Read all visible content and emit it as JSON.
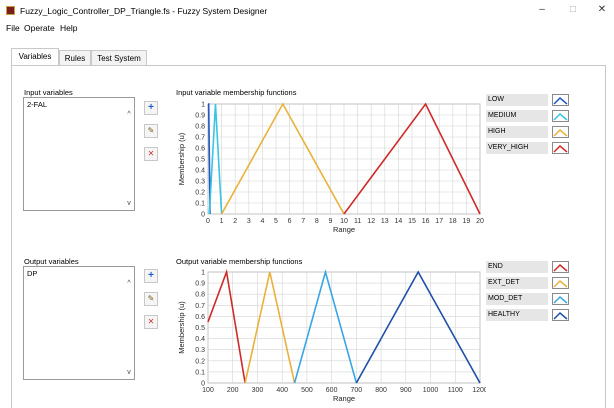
{
  "window": {
    "title": "Fuzzy_Logic_Controller_DP_Triangle.fs - Fuzzy System Designer",
    "minimize": "–",
    "maximize": "□",
    "close": "✕"
  },
  "menu": [
    "File",
    "Operate",
    "Help"
  ],
  "tabs": [
    "Variables",
    "Rules",
    "Test System"
  ],
  "input": {
    "list_label": "Input variables",
    "items": [
      "2-FAL"
    ],
    "chart_label": "Input variable membership functions",
    "legend": [
      {
        "name": "LOW",
        "color": "#1f57c3"
      },
      {
        "name": "MEDIUM",
        "color": "#38c4e6"
      },
      {
        "name": "HIGH",
        "color": "#e9b03b"
      },
      {
        "name": "VERY_HIGH",
        "color": "#d02a2a"
      }
    ]
  },
  "output": {
    "list_label": "Output variables",
    "items": [
      "DP"
    ],
    "chart_label": "Output variable membership functions",
    "legend": [
      {
        "name": "END",
        "color": "#d02a2a"
      },
      {
        "name": "EXT_DET",
        "color": "#e9b03b"
      },
      {
        "name": "MOD_DET",
        "color": "#38a6e6"
      },
      {
        "name": "HEALTHY",
        "color": "#1f4fa8"
      }
    ]
  },
  "buttons": {
    "add": "+",
    "edit": "✎",
    "delete": "✕"
  },
  "chart_data": [
    {
      "type": "line",
      "title": "Input variable membership functions",
      "xlabel": "Range",
      "ylabel": "Membership (u)",
      "xlim": [
        0,
        20
      ],
      "ylim": [
        0,
        1
      ],
      "xticks": [
        "0",
        "1",
        "2",
        "3",
        "4",
        "5",
        "6",
        "7",
        "8",
        "9",
        "10",
        "11",
        "12",
        "13",
        "14",
        "15",
        "16",
        "17",
        "18",
        "19",
        "20"
      ],
      "yticks": [
        "0",
        "0.1",
        "0.2",
        "0.3",
        "0.4",
        "0.5",
        "0.6",
        "0.7",
        "0.8",
        "0.9",
        "1"
      ],
      "series": [
        {
          "name": "LOW",
          "color": "#1f57c3",
          "x": [
            0,
            0.05,
            0.15
          ],
          "y": [
            1,
            1,
            0
          ]
        },
        {
          "name": "MEDIUM",
          "color": "#38c4e6",
          "x": [
            0.1,
            0.55,
            1
          ],
          "y": [
            0,
            1,
            0
          ]
        },
        {
          "name": "HIGH",
          "color": "#e9b03b",
          "x": [
            1,
            5.5,
            10
          ],
          "y": [
            0,
            1,
            0
          ]
        },
        {
          "name": "VERY_HIGH",
          "color": "#d02a2a",
          "x": [
            10,
            16,
            20
          ],
          "y": [
            0,
            1,
            0
          ]
        }
      ]
    },
    {
      "type": "line",
      "title": "Output variable membership functions",
      "xlabel": "Range",
      "ylabel": "Membership (u)",
      "xlim": [
        100,
        1200
      ],
      "ylim": [
        0,
        1
      ],
      "xticks": [
        "100",
        "200",
        "300",
        "400",
        "500",
        "600",
        "700",
        "800",
        "900",
        "1000",
        "1100",
        "1200"
      ],
      "yticks": [
        "0",
        "0.1",
        "0.2",
        "0.3",
        "0.4",
        "0.5",
        "0.6",
        "0.7",
        "0.8",
        "0.9",
        "1"
      ],
      "series": [
        {
          "name": "END",
          "color": "#d02a2a",
          "x": [
            100,
            175,
            250
          ],
          "y": [
            0.55,
            1,
            0
          ]
        },
        {
          "name": "EXT_DET",
          "color": "#e9b03b",
          "x": [
            250,
            350,
            450
          ],
          "y": [
            0,
            1,
            0
          ]
        },
        {
          "name": "MOD_DET",
          "color": "#38a6e6",
          "x": [
            450,
            575,
            700
          ],
          "y": [
            0,
            1,
            0
          ]
        },
        {
          "name": "HEALTHY",
          "color": "#1f4fa8",
          "x": [
            700,
            950,
            1200
          ],
          "y": [
            0,
            1,
            0
          ]
        }
      ]
    }
  ]
}
